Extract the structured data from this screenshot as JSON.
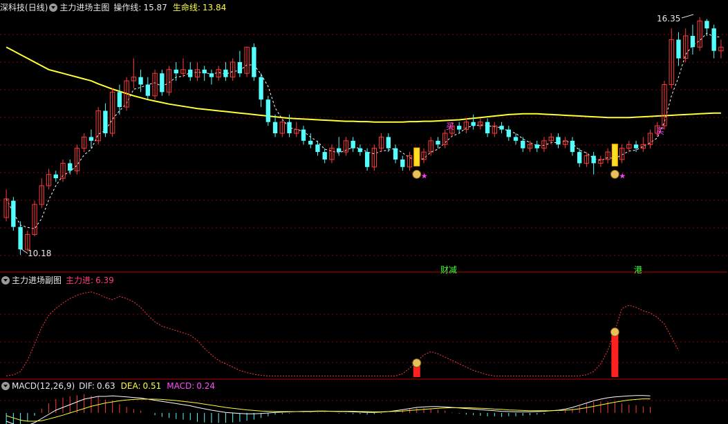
{
  "main_panel": {
    "stock_name": "深科技",
    "period": "(日线)",
    "indicator_name": "主力进场主图",
    "op_line_label": "操作线:",
    "op_line_value": "15.87",
    "life_line_label": "生命线:",
    "life_line_value": "13.84",
    "high_marker": "16.35",
    "low_marker": "10.18",
    "buy_label": "买",
    "news_tags": [
      "财减",
      "港"
    ]
  },
  "sub_panel": {
    "indicator_name": "主力进场副图",
    "value_label": "主力进:",
    "value": "6.39"
  },
  "macd_panel": {
    "indicator_name": "MACD(12,26,9)",
    "dif_label": "DIF:",
    "dif_value": "0.63",
    "dea_label": "DEA:",
    "dea_value": "0.51",
    "macd_label": "MACD:",
    "macd_value": "0.24"
  },
  "colors": {
    "up": "#ff3b3b",
    "down": "#54ffff",
    "life_line": "#ffff33",
    "op_line": "#ffffff",
    "signal_red": "#ff2020",
    "pink": "#ff40ff",
    "grid": "#8b0000"
  },
  "chart_data": {
    "type": "candlestick",
    "y_range": [
      10.0,
      16.6
    ],
    "candles": [
      [
        11.05,
        11.55,
        10.95,
        11.8
      ],
      [
        11.5,
        10.8,
        10.7,
        11.6
      ],
      [
        10.8,
        10.2,
        10.05,
        10.95
      ],
      [
        10.2,
        10.6,
        10.15,
        10.7
      ],
      [
        10.6,
        11.4,
        10.55,
        11.5
      ],
      [
        11.4,
        11.9,
        11.3,
        12.1
      ],
      [
        11.9,
        12.2,
        11.8,
        12.35
      ],
      [
        12.2,
        12.1,
        12.0,
        12.3
      ],
      [
        12.1,
        12.5,
        12.0,
        12.6
      ],
      [
        12.5,
        12.3,
        12.2,
        12.6
      ],
      [
        12.3,
        12.9,
        12.2,
        13.0
      ],
      [
        12.9,
        13.2,
        12.8,
        13.3
      ],
      [
        13.2,
        13.1,
        12.9,
        13.4
      ],
      [
        13.1,
        13.9,
        13.0,
        14.0
      ],
      [
        13.9,
        13.3,
        13.2,
        14.1
      ],
      [
        13.3,
        14.4,
        13.2,
        14.5
      ],
      [
        14.4,
        14.0,
        13.8,
        14.6
      ],
      [
        14.0,
        14.7,
        13.9,
        14.8
      ],
      [
        14.7,
        14.8,
        14.5,
        15.3
      ],
      [
        14.8,
        14.6,
        14.4,
        15.0
      ],
      [
        14.6,
        14.3,
        14.2,
        14.8
      ],
      [
        14.3,
        14.9,
        14.2,
        15.0
      ],
      [
        14.9,
        14.4,
        14.3,
        15.0
      ],
      [
        14.4,
        15.0,
        14.3,
        15.1
      ],
      [
        15.0,
        14.9,
        14.7,
        15.2
      ],
      [
        14.9,
        15.0,
        14.8,
        15.3
      ],
      [
        15.0,
        14.8,
        14.7,
        15.2
      ],
      [
        14.8,
        15.0,
        14.7,
        15.2
      ],
      [
        15.0,
        14.9,
        14.7,
        15.1
      ],
      [
        14.9,
        14.8,
        14.6,
        15.0
      ],
      [
        14.8,
        15.0,
        14.7,
        15.1
      ],
      [
        15.0,
        14.8,
        14.7,
        15.2
      ],
      [
        14.8,
        15.2,
        14.7,
        15.3
      ],
      [
        15.2,
        14.9,
        14.8,
        15.5
      ],
      [
        14.9,
        15.6,
        14.8,
        15.6
      ],
      [
        15.6,
        14.8,
        14.7,
        15.7
      ],
      [
        14.8,
        14.2,
        14.0,
        14.9
      ],
      [
        14.2,
        13.6,
        13.5,
        14.3
      ],
      [
        13.6,
        13.3,
        13.2,
        13.8
      ],
      [
        13.3,
        13.6,
        13.2,
        13.7
      ],
      [
        13.6,
        13.3,
        13.2,
        13.8
      ],
      [
        13.3,
        13.4,
        13.2,
        13.6
      ],
      [
        13.4,
        13.1,
        13.0,
        13.5
      ],
      [
        13.1,
        13.0,
        12.9,
        13.3
      ],
      [
        13.0,
        12.8,
        12.7,
        13.1
      ],
      [
        12.8,
        12.6,
        12.5,
        12.9
      ],
      [
        12.6,
        12.9,
        12.5,
        13.0
      ],
      [
        12.9,
        12.8,
        12.7,
        13.2
      ],
      [
        12.8,
        13.1,
        12.7,
        13.2
      ],
      [
        13.1,
        12.9,
        12.8,
        13.2
      ],
      [
        12.9,
        12.8,
        12.7,
        13.0
      ],
      [
        12.8,
        12.4,
        12.3,
        12.9
      ],
      [
        12.4,
        12.9,
        12.3,
        13.0
      ],
      [
        12.9,
        13.2,
        12.8,
        13.3
      ],
      [
        13.2,
        12.9,
        12.8,
        13.3
      ],
      [
        12.9,
        12.6,
        12.5,
        13.0
      ],
      [
        12.6,
        12.4,
        12.3,
        12.7
      ],
      [
        12.4,
        12.7,
        12.3,
        12.8
      ],
      [
        12.7,
        12.6,
        12.5,
        12.8
      ],
      [
        12.6,
        12.8,
        12.5,
        12.9
      ],
      [
        12.8,
        13.1,
        12.7,
        13.2
      ],
      [
        13.1,
        13.0,
        12.9,
        13.2
      ],
      [
        13.0,
        13.3,
        12.9,
        13.4
      ],
      [
        13.3,
        13.5,
        13.2,
        13.6
      ],
      [
        13.5,
        13.4,
        13.3,
        13.6
      ],
      [
        13.4,
        13.6,
        13.3,
        13.7
      ],
      [
        13.6,
        13.5,
        13.4,
        13.8
      ],
      [
        13.5,
        13.6,
        13.4,
        13.7
      ],
      [
        13.6,
        13.3,
        13.2,
        13.7
      ],
      [
        13.3,
        13.5,
        13.2,
        13.6
      ],
      [
        13.5,
        13.4,
        13.3,
        13.6
      ],
      [
        13.4,
        13.2,
        13.1,
        13.5
      ],
      [
        13.2,
        13.1,
        13.0,
        13.3
      ],
      [
        13.1,
        12.9,
        12.8,
        13.2
      ],
      [
        12.9,
        13.0,
        12.8,
        13.1
      ],
      [
        13.0,
        12.9,
        12.8,
        13.1
      ],
      [
        12.9,
        13.1,
        12.8,
        13.2
      ],
      [
        13.1,
        13.2,
        13.0,
        13.3
      ],
      [
        13.2,
        13.0,
        12.9,
        13.3
      ],
      [
        13.0,
        13.1,
        12.9,
        13.2
      ],
      [
        13.1,
        12.8,
        12.7,
        13.2
      ],
      [
        12.8,
        12.5,
        12.4,
        12.9
      ],
      [
        12.5,
        12.7,
        12.4,
        12.8
      ],
      [
        12.7,
        12.5,
        12.2,
        12.8
      ],
      [
        12.5,
        12.6,
        12.4,
        12.7
      ],
      [
        12.6,
        12.8,
        12.5,
        12.9
      ],
      [
        12.8,
        12.6,
        12.5,
        12.9
      ],
      [
        12.6,
        12.9,
        12.5,
        13.0
      ],
      [
        12.9,
        13.0,
        12.8,
        13.1
      ],
      [
        13.0,
        12.9,
        12.8,
        13.1
      ],
      [
        12.9,
        13.0,
        12.8,
        13.2
      ],
      [
        13.0,
        13.3,
        12.9,
        13.4
      ],
      [
        13.3,
        13.5,
        13.2,
        13.6
      ],
      [
        13.5,
        14.6,
        13.4,
        14.7
      ],
      [
        14.6,
        15.8,
        14.5,
        16.1
      ],
      [
        15.8,
        15.3,
        15.1,
        16.0
      ],
      [
        15.3,
        15.9,
        15.2,
        16.1
      ],
      [
        15.9,
        15.6,
        15.4,
        16.2
      ],
      [
        15.6,
        16.3,
        15.5,
        16.4
      ],
      [
        16.3,
        16.1,
        15.9,
        16.35
      ],
      [
        16.1,
        15.5,
        15.3,
        16.2
      ],
      [
        15.5,
        15.6,
        15.3,
        15.8
      ]
    ],
    "life_line": [
      15.6,
      15.5,
      15.4,
      15.3,
      15.2,
      15.1,
      15.0,
      14.95,
      14.9,
      14.85,
      14.8,
      14.75,
      14.7,
      14.62,
      14.55,
      14.48,
      14.42,
      14.36,
      14.3,
      14.25,
      14.2,
      14.16,
      14.12,
      14.08,
      14.05,
      14.02,
      13.99,
      13.96,
      13.94,
      13.92,
      13.9,
      13.88,
      13.86,
      13.84,
      13.82,
      13.8,
      13.78,
      13.76,
      13.74,
      13.72,
      13.7,
      13.69,
      13.68,
      13.67,
      13.66,
      13.65,
      13.64,
      13.63,
      13.62,
      13.62,
      13.61,
      13.61,
      13.6,
      13.6,
      13.6,
      13.6,
      13.6,
      13.61,
      13.61,
      13.62,
      13.62,
      13.63,
      13.64,
      13.65,
      13.66,
      13.68,
      13.7,
      13.72,
      13.74,
      13.76,
      13.78,
      13.8,
      13.81,
      13.82,
      13.82,
      13.82,
      13.81,
      13.8,
      13.79,
      13.78,
      13.77,
      13.76,
      13.75,
      13.74,
      13.73,
      13.72,
      13.72,
      13.72,
      13.72,
      13.73,
      13.74,
      13.75,
      13.76,
      13.77,
      13.78,
      13.79,
      13.8,
      13.81,
      13.82,
      13.83,
      13.84,
      13.84
    ],
    "signals": [
      {
        "index": 58
      },
      {
        "index": 86
      }
    ],
    "sub_curve": [
      0.1,
      0.2,
      0.5,
      1.5,
      3,
      4.5,
      5.6,
      6.2,
      6.7,
      7.1,
      7.4,
      7.6,
      7.7,
      7.5,
      7.2,
      7.0,
      7.3,
      7.1,
      6.8,
      6.3,
      5.6,
      5.0,
      4.6,
      4.4,
      4.2,
      4.0,
      3.8,
      3.3,
      2.6,
      2.0,
      1.5,
      1.2,
      0.9,
      0.6,
      0.4,
      0.25,
      0.15,
      0.1,
      0.1,
      0.1,
      0.1,
      0.1,
      0.1,
      0.1,
      0.1,
      0.1,
      0.1,
      0.1,
      0.1,
      0.1,
      0.1,
      0.1,
      0.1,
      0.1,
      0.1,
      0.1,
      0.3,
      0.8,
      1.4,
      2.0,
      2.3,
      2.1,
      1.8,
      1.5,
      1.2,
      0.9,
      0.6,
      0.4,
      0.2,
      0.1,
      0.1,
      0.1,
      0.1,
      0.1,
      0.1,
      0.1,
      0.1,
      0.1,
      0.1,
      0.1,
      0.1,
      0.1,
      0.2,
      0.5,
      1.2,
      2.4,
      4.2,
      6.2,
      6.5,
      6.3,
      6.0,
      5.8,
      5.4,
      4.8,
      3.6,
      2.4
    ],
    "macd_dif": [
      -0.3,
      -0.4,
      -0.5,
      -0.45,
      -0.35,
      -0.2,
      -0.05,
      0.1,
      0.2,
      0.3,
      0.4,
      0.5,
      0.55,
      0.6,
      0.6,
      0.62,
      0.6,
      0.58,
      0.56,
      0.54,
      0.5,
      0.46,
      0.42,
      0.38,
      0.34,
      0.3,
      0.26,
      0.2,
      0.15,
      0.1,
      0.06,
      0.02,
      0.0,
      -0.02,
      -0.03,
      -0.03,
      -0.02,
      0.0,
      0.02,
      0.03,
      0.04,
      0.05,
      0.06,
      0.06,
      0.07,
      0.07,
      0.06,
      0.05,
      0.05,
      0.04,
      0.03,
      0.02,
      0.02,
      0.03,
      0.05,
      0.08,
      0.12,
      0.16,
      0.2,
      0.22,
      0.23,
      0.23,
      0.22,
      0.2,
      0.18,
      0.16,
      0.14,
      0.12,
      0.1,
      0.08,
      0.06,
      0.05,
      0.04,
      0.04,
      0.04,
      0.05,
      0.06,
      0.08,
      0.1,
      0.14,
      0.2,
      0.28,
      0.36,
      0.44,
      0.5,
      0.55,
      0.58,
      0.6,
      0.62,
      0.63,
      0.63,
      0.62
    ],
    "macd_dea": [
      -0.1,
      -0.18,
      -0.26,
      -0.3,
      -0.3,
      -0.28,
      -0.22,
      -0.15,
      -0.08,
      0.0,
      0.08,
      0.16,
      0.24,
      0.3,
      0.36,
      0.4,
      0.44,
      0.47,
      0.49,
      0.5,
      0.5,
      0.5,
      0.49,
      0.47,
      0.45,
      0.42,
      0.39,
      0.36,
      0.32,
      0.28,
      0.24,
      0.2,
      0.17,
      0.14,
      0.11,
      0.09,
      0.07,
      0.06,
      0.05,
      0.05,
      0.05,
      0.05,
      0.05,
      0.05,
      0.06,
      0.06,
      0.06,
      0.06,
      0.06,
      0.06,
      0.05,
      0.05,
      0.04,
      0.04,
      0.05,
      0.06,
      0.07,
      0.09,
      0.11,
      0.13,
      0.15,
      0.17,
      0.18,
      0.19,
      0.19,
      0.19,
      0.18,
      0.17,
      0.16,
      0.14,
      0.13,
      0.11,
      0.1,
      0.09,
      0.08,
      0.08,
      0.08,
      0.08,
      0.09,
      0.1,
      0.12,
      0.15,
      0.19,
      0.24,
      0.29,
      0.34,
      0.39,
      0.43,
      0.47,
      0.49,
      0.51,
      0.51
    ]
  }
}
